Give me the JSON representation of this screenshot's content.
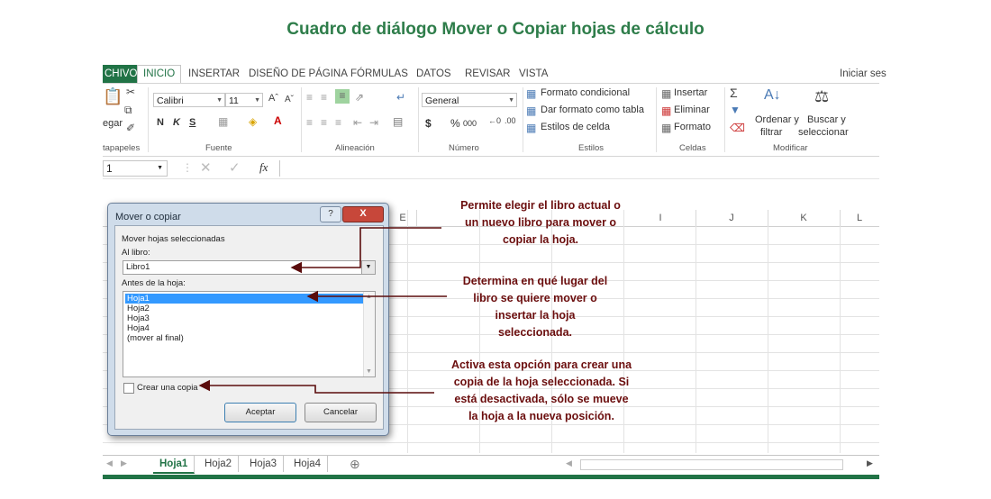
{
  "title": "Cuadro de diálogo Mover o Copiar hojas de cálculo",
  "ribbon": {
    "tabs": [
      "CHIVO",
      "INICIO",
      "INSERTAR",
      "DISEÑO DE PÁGINA",
      "FÓRMULAS",
      "DATOS",
      "REVISAR",
      "VISTA"
    ],
    "signin": "Iniciar ses",
    "clipboard": {
      "paste": "egar",
      "group": "tapapeles"
    },
    "font": {
      "name": "Calibri",
      "size": "11",
      "bold": "N",
      "italic": "K",
      "underline": "S",
      "group": "Fuente"
    },
    "alignment": {
      "group": "Alineación"
    },
    "number": {
      "format": "General",
      "currency": "$",
      "percent": "%",
      "thousands": "000",
      "group": "Número"
    },
    "styles": {
      "conditional": "Formato condicional",
      "table": "Dar formato como tabla",
      "cell": "Estilos de celda",
      "group": "Estilos"
    },
    "cells": {
      "insert": "Insertar",
      "delete": "Eliminar",
      "format": "Formato",
      "group": "Celdas"
    },
    "editing": {
      "sort1": "Ordenar y",
      "sort2": "filtrar",
      "find1": "Buscar y",
      "find2": "seleccionar",
      "group": "Modificar"
    }
  },
  "formula_bar": {
    "name_box": "1",
    "fx": "fx"
  },
  "columns": [
    "E",
    "I",
    "J",
    "K",
    "L"
  ],
  "dialog": {
    "title": "Mover o copiar",
    "help": "?",
    "close": "X",
    "move_label": "Mover hojas seleccionadas",
    "book_label": "Al libro:",
    "book_value": "Libro1",
    "before_label": "Antes de la hoja:",
    "sheets": [
      "Hoja1",
      "Hoja2",
      "Hoja3",
      "Hoja4",
      "(mover al final)"
    ],
    "selected_sheet": "Hoja1",
    "copy_label": "Crear una copia",
    "copy_checked": false,
    "ok": "Aceptar",
    "cancel": "Cancelar"
  },
  "sheet_tabs": [
    "Hoja1",
    "Hoja2",
    "Hoja3",
    "Hoja4"
  ],
  "active_sheet": "Hoja1",
  "callouts": [
    [
      "Permite elegir el libro actual o",
      "un nuevo libro para mover o",
      "copiar la hoja."
    ],
    [
      "Determina en qué lugar del",
      "libro se quiere mover o",
      "insertar la hoja",
      "seleccionada."
    ],
    [
      "Activa esta opción para crear una",
      "copia de la hoja seleccionada.  Si",
      "está desactivada, sólo se mueve",
      "la hoja a la nueva posición."
    ]
  ],
  "colors": {
    "title": "#2e7d4a",
    "excel_green": "#217346",
    "callout_text": "#6b0e0e",
    "arrow": "#5a0c0c",
    "selection": "#3399ff"
  }
}
